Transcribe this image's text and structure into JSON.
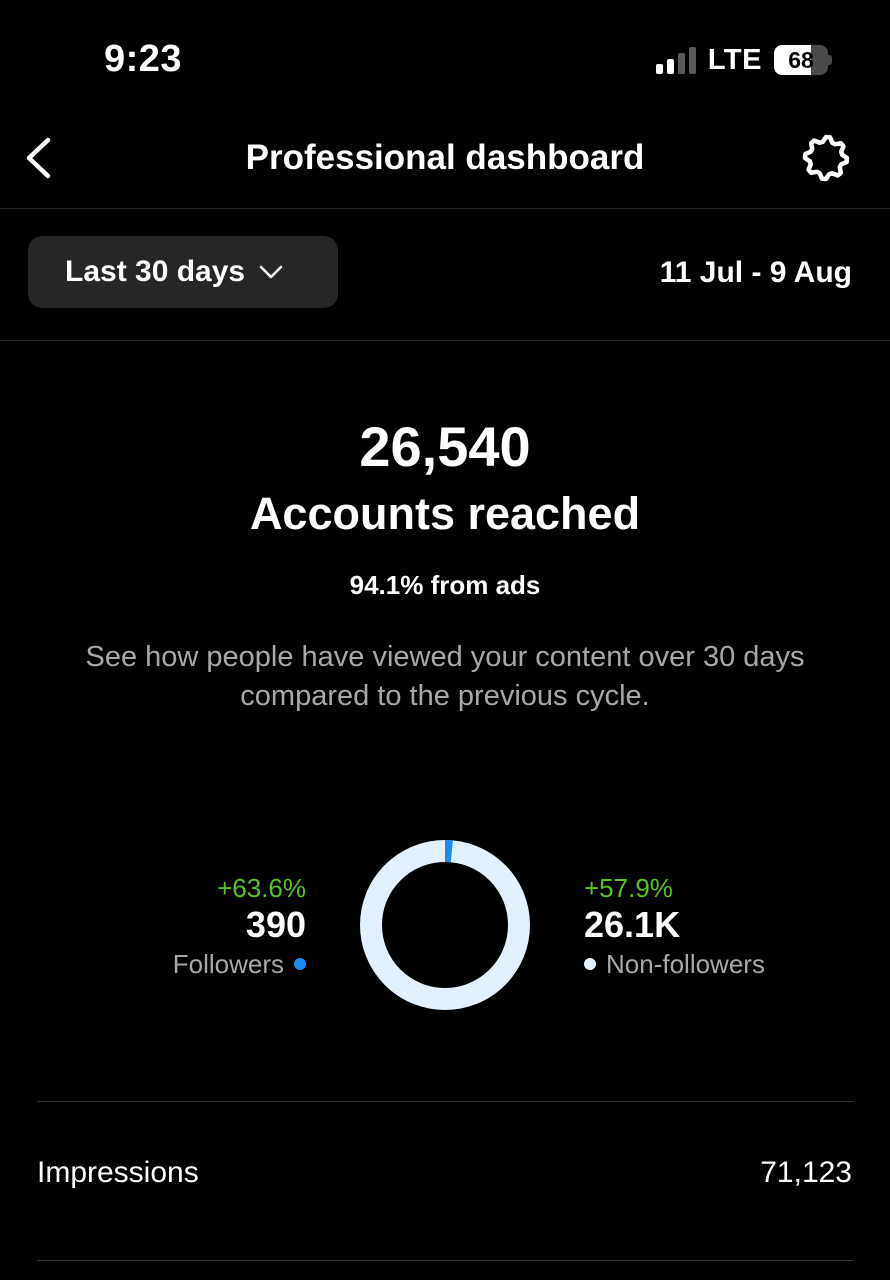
{
  "status_bar": {
    "time": "9:23",
    "network": "LTE",
    "battery": "68",
    "battery_level_pct": 68,
    "signal_bars_filled": 2,
    "signal_bars_total": 4
  },
  "header": {
    "title": "Professional dashboard",
    "back_icon": "chevron-left-icon",
    "settings_icon": "gear-icon"
  },
  "filter": {
    "range_label": "Last 30 days",
    "dropdown_icon": "chevron-down-icon",
    "date_range": "11 Jul - 9 Aug"
  },
  "summary": {
    "accounts_reached": "26,540",
    "accounts_reached_label": "Accounts reached",
    "ads_note": "94.1% from ads",
    "description": "See how people have viewed your content over 30 days compared to the previous cycle."
  },
  "breakdown": {
    "followers": {
      "change": "+63.6%",
      "value": "390",
      "label": "Followers",
      "color": "#1a8cf0",
      "count": 390
    },
    "non_followers": {
      "change": "+57.9%",
      "value": "26.1K",
      "label": "Non-followers",
      "color": "#e3f1ff",
      "count": 26100
    },
    "positive_color": "#58c322"
  },
  "metrics": [
    {
      "label": "Impressions",
      "value": "71,123"
    }
  ]
}
